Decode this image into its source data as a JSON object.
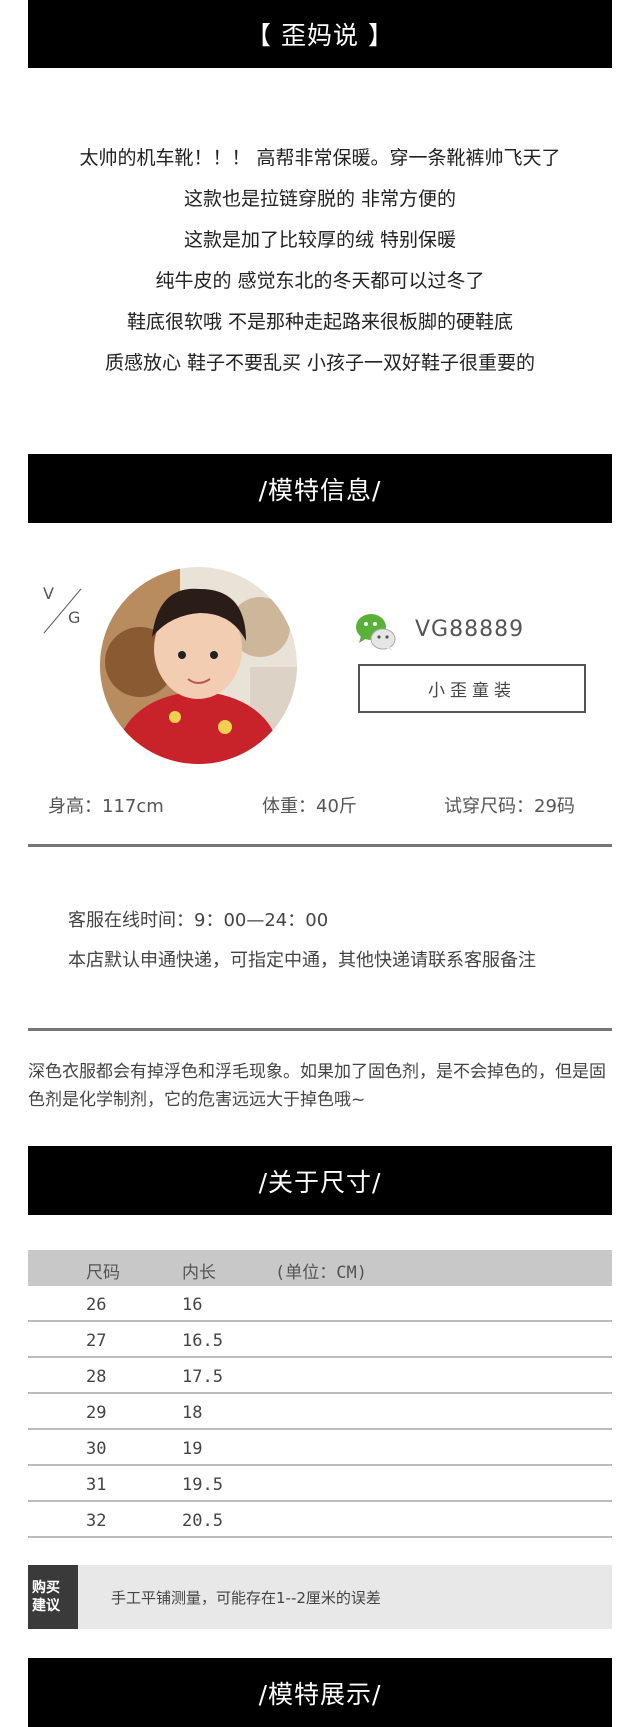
{
  "banners": {
    "wai_ma_shuo": "【 歪妈说 】",
    "model_info": "/模特信息/",
    "about_size": "/关于尺寸/",
    "model_show": "/模特展示/"
  },
  "intro_lines": [
    "太帅的机车靴！！！ 高帮非常保暖。穿一条靴裤帅飞天了",
    "这款也是拉链穿脱的  非常方便的",
    "这款是加了比较厚的绒  特别保暖",
    "纯牛皮的  感觉东北的冬天都可以过冬了",
    "鞋底很软哦  不是那种走起路来很板脚的硬鞋底",
    "质感放心   鞋子不要乱买  小孩子一双好鞋子很重要的"
  ],
  "logo": {
    "v": "V",
    "g": "G"
  },
  "model": {
    "wechat_icon": "wechat-icon",
    "wechat_id": "VG88889",
    "shop_button": "小歪童装",
    "height": "身高：117cm",
    "weight": "体重：40斤",
    "size": "试穿尺码：29码"
  },
  "service": {
    "hours": "客服在线时间：9：00—24：00",
    "shipping": "本店默认申通快递，可指定中通，其他快递请联系客服备注"
  },
  "notice": "深色衣服都会有掉浮色和浮毛现象。如果加了固色剂，是不会掉色的，但是固色剂是化学制剂，它的危害远远大于掉色哦~",
  "size_table": {
    "headers": [
      "尺码",
      "内长",
      "(单位：CM)"
    ],
    "rows": [
      [
        "26",
        "16"
      ],
      [
        "27",
        "16.5"
      ],
      [
        "28",
        "17.5"
      ],
      [
        "29",
        "18"
      ],
      [
        "30",
        "19"
      ],
      [
        "31",
        "19.5"
      ],
      [
        "32",
        "20.5"
      ]
    ]
  },
  "advice": {
    "label_line1": "购买",
    "label_line2": "建议",
    "text": "手工平铺测量，可能存在1--2厘米的误差"
  },
  "colors": {
    "banner_bg": "#000000",
    "rule": "#777777",
    "table_head": "#c8c8c8"
  }
}
